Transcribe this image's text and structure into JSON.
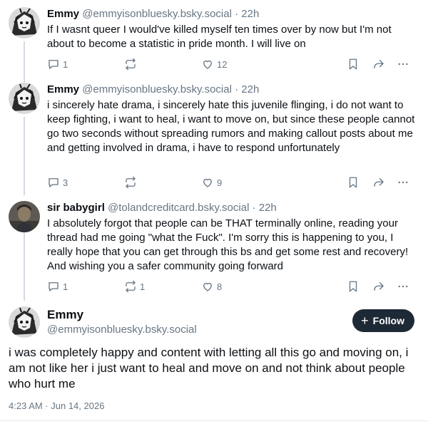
{
  "posts": [
    {
      "name": "Emmy",
      "handle": "@emmyisonbluesky.bsky.social",
      "dot": "·",
      "time": "22h",
      "text": "If I wasnt queer I would've killed myself ten times over by now but I'm not about to become a statistic in pride month. I will live on",
      "reply_count": "1",
      "repost_count": "",
      "like_count": "12"
    },
    {
      "name": "Emmy",
      "handle": "@emmyisonbluesky.bsky.social",
      "dot": "·",
      "time": "22h",
      "text": "i sincerely hate drama, i sincerely hate this juvenile flinging, i do not want to keep fighting, i want to heal, i want to move on, but since these people cannot go two seconds without spreading rumors and making callout posts about me and getting involved in drama, i have to respond unfortunately",
      "reply_count": "3",
      "repost_count": "",
      "like_count": "9"
    },
    {
      "name": "sir babygirl",
      "handle": "@tolandcreditcard.bsky.social",
      "dot": "·",
      "time": "22h",
      "text": "I absolutely forgot that people can be THAT terminally online, reading your thread had me going \"what the Fuck\". I'm sorry this is happening to you, I really hope that you can get through this bs and get some rest and recovery! And wishing you a safer community going forward",
      "reply_count": "1",
      "repost_count": "1",
      "like_count": "8"
    }
  ],
  "main_post": {
    "name": "Emmy",
    "handle": "@emmyisonbluesky.bsky.social",
    "follow_label": "Follow",
    "text": "i was completely happy and content with letting all this go and moving on, i am not like her i just want to heal and move on and not think about people who hurt me",
    "timestamp": "4:23 AM · Jun 14, 2026"
  },
  "icons": {
    "reply": "reply-icon",
    "repost": "repost-icon",
    "like": "heart-icon",
    "bookmark": "bookmark-icon",
    "share": "share-icon",
    "more": "more-icon"
  },
  "colors": {
    "muted": "#687684",
    "follow_bg": "#1e2936",
    "thread_line": "#d4dbe2"
  }
}
